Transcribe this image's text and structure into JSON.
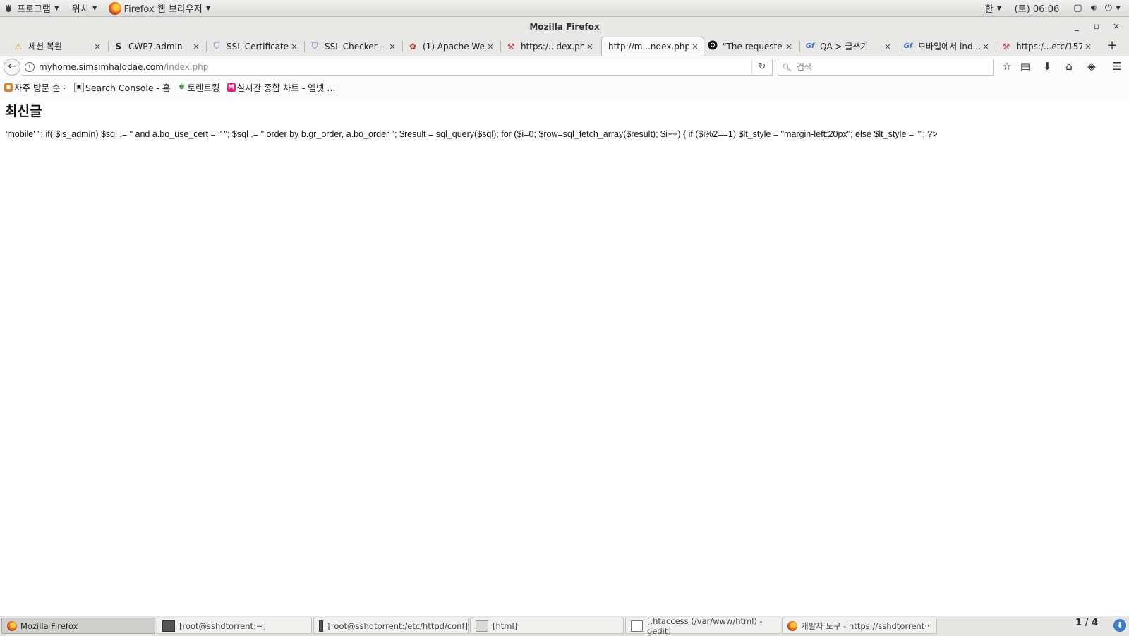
{
  "topbar": {
    "apps_menu": "프로그램",
    "places_menu": "위치",
    "app_name": "Firefox 웹 브라우저",
    "input_method": "한",
    "clock": "(토) 06:06"
  },
  "window": {
    "title": "Mozilla Firefox",
    "minimize": "_",
    "maximize": "▫",
    "close": "×"
  },
  "tabs": [
    {
      "label": "세션 복원",
      "icon": "⚠"
    },
    {
      "label": "CWP7.admin",
      "icon": "S"
    },
    {
      "label": "SSL Certificate...",
      "icon": "shield"
    },
    {
      "label": "SSL Checker - ...",
      "icon": "shield"
    },
    {
      "label": "(1) Apache We...",
      "icon": "bug"
    },
    {
      "label": "https:/...dex.php",
      "icon": "puzzle"
    },
    {
      "label": "http://m...ndex.php",
      "icon": ""
    },
    {
      "label": "\"The requeste...",
      "icon": "github"
    },
    {
      "label": "QA > 글쓰기",
      "icon": "gf"
    },
    {
      "label": "모바일에서 ind...",
      "icon": "gf"
    },
    {
      "label": "https:/...etc/157",
      "icon": "puzzle"
    }
  ],
  "tab_close": "×",
  "new_tab": "+",
  "navbar": {
    "url_host": "myhome.simsimhalddae.com",
    "url_path": "/index.php",
    "search_placeholder": "검색"
  },
  "bookmarks": [
    {
      "label": "자주 방문 순"
    },
    {
      "label": "Search Console - 홈"
    },
    {
      "label": "토렌트킹"
    },
    {
      "label": "실시간 종합 차트 - 엠넷 ..."
    }
  ],
  "page": {
    "heading": "최신글",
    "code_text": "'mobile' \"; if(!$is_admin) $sql .= \" and a.bo_use_cert = '' \"; $sql .= \" order by b.gr_order, a.bo_order \"; $result = sql_query($sql); for ($i=0; $row=sql_fetch_array($result); $i++) { if ($i%2==1) $lt_style = \"margin-left:20px\"; else $lt_style = \"\"; ?>"
  },
  "taskbar": {
    "items": [
      {
        "label": "Mozilla Firefox"
      },
      {
        "label": "[root@sshdtorrent:~]"
      },
      {
        "label": "[root@sshdtorrent:/etc/httpd/conf]"
      },
      {
        "label": "[html]"
      },
      {
        "label": "[.htaccess (/var/www/html) - gedit]"
      },
      {
        "label": "개발자 도구 - https://sshdtorrent···"
      }
    ],
    "pager": "1 / 4"
  }
}
